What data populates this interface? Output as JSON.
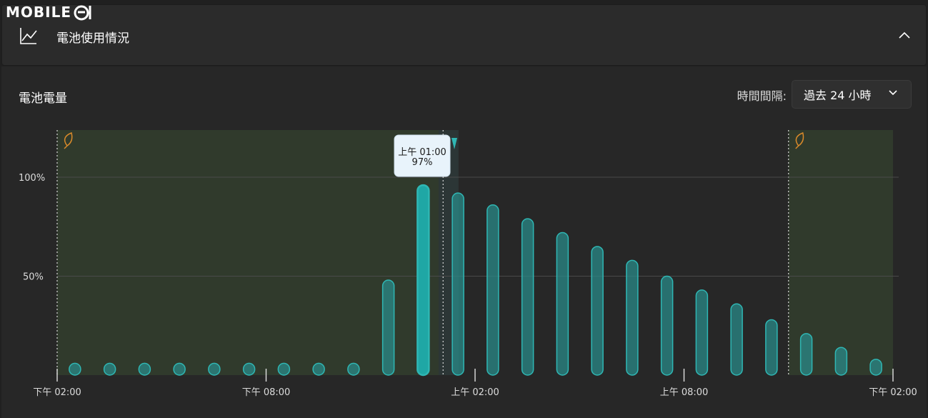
{
  "watermark": {
    "text": "MOBILE"
  },
  "header": {
    "title": "電池使用情況"
  },
  "section": {
    "title": "電池電量",
    "interval_label": "時間間隔:",
    "interval_value": "過去 24 小時"
  },
  "colors": {
    "bar_fill": "#2a8a88",
    "bar_stroke": "#2fb7b4",
    "selected_fill": "#1fa7a5",
    "saver_band": "#303a2c",
    "leaf": "#d98a2a"
  },
  "tooltip": {
    "time": "上午 01:00",
    "value": "97%"
  },
  "chart_data": {
    "type": "bar",
    "ylabel": "",
    "ylim": [
      0,
      100
    ],
    "y_ticks": [
      "100%",
      "50%"
    ],
    "x_tick_labels": [
      "下午 02:00",
      "下午 08:00",
      "上午 02:00",
      "上午 08:00",
      "下午 02:00"
    ],
    "values": [
      6,
      6,
      6,
      6,
      6,
      6,
      6,
      6,
      6,
      48,
      96,
      92,
      86,
      79,
      72,
      65,
      58,
      50,
      43,
      36,
      28,
      21,
      14,
      8
    ],
    "selected_index": 10,
    "battery_saver_ranges": [
      [
        0,
        11
      ],
      [
        21,
        24
      ]
    ],
    "grid": true
  }
}
